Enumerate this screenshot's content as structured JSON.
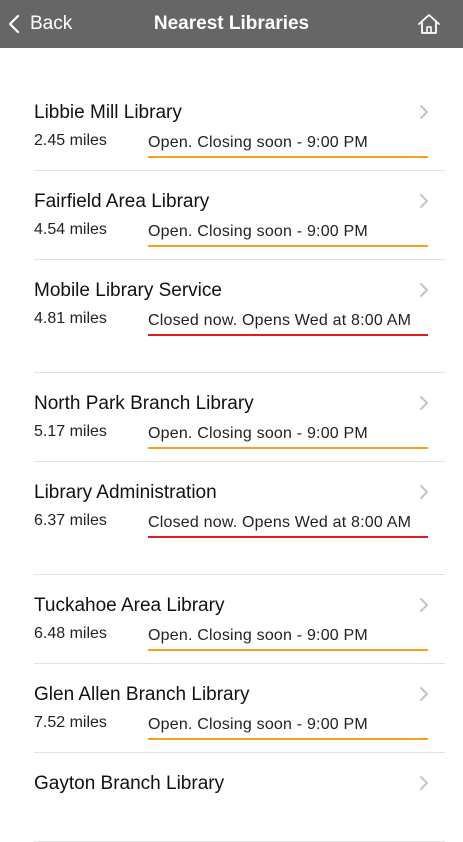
{
  "header": {
    "back_label": "Back",
    "title": "Nearest Libraries",
    "back_icon": "chevron-left-icon",
    "home_icon": "home-icon"
  },
  "colors": {
    "header_bg": "#666666",
    "open_underline": "#f4a21d",
    "closed_underline": "#e01b1b"
  },
  "libraries": [
    {
      "name": "Libbie Mill Library",
      "distance": "2.45 miles",
      "status": "Open. Closing soon - 9:00 PM",
      "state": "open"
    },
    {
      "name": "Fairfield Area Library",
      "distance": "4.54 miles",
      "status": "Open. Closing soon - 9:00 PM",
      "state": "open"
    },
    {
      "name": "Mobile Library Service",
      "distance": "4.81 miles",
      "status": "Closed now. Opens Wed at 8:00 AM",
      "state": "closed"
    },
    {
      "name": "North Park Branch Library",
      "distance": "5.17 miles",
      "status": "Open. Closing soon - 9:00 PM",
      "state": "open"
    },
    {
      "name": "Library Administration",
      "distance": "6.37 miles",
      "status": "Closed now. Opens Wed at 8:00 AM",
      "state": "closed"
    },
    {
      "name": "Tuckahoe Area Library",
      "distance": "6.48 miles",
      "status": "Open. Closing soon - 9:00 PM",
      "state": "open"
    },
    {
      "name": "Glen Allen Branch Library",
      "distance": "7.52 miles",
      "status": "Open. Closing soon - 9:00 PM",
      "state": "open"
    },
    {
      "name": "Gayton Branch Library",
      "distance": "",
      "status": "",
      "state": "open"
    }
  ]
}
